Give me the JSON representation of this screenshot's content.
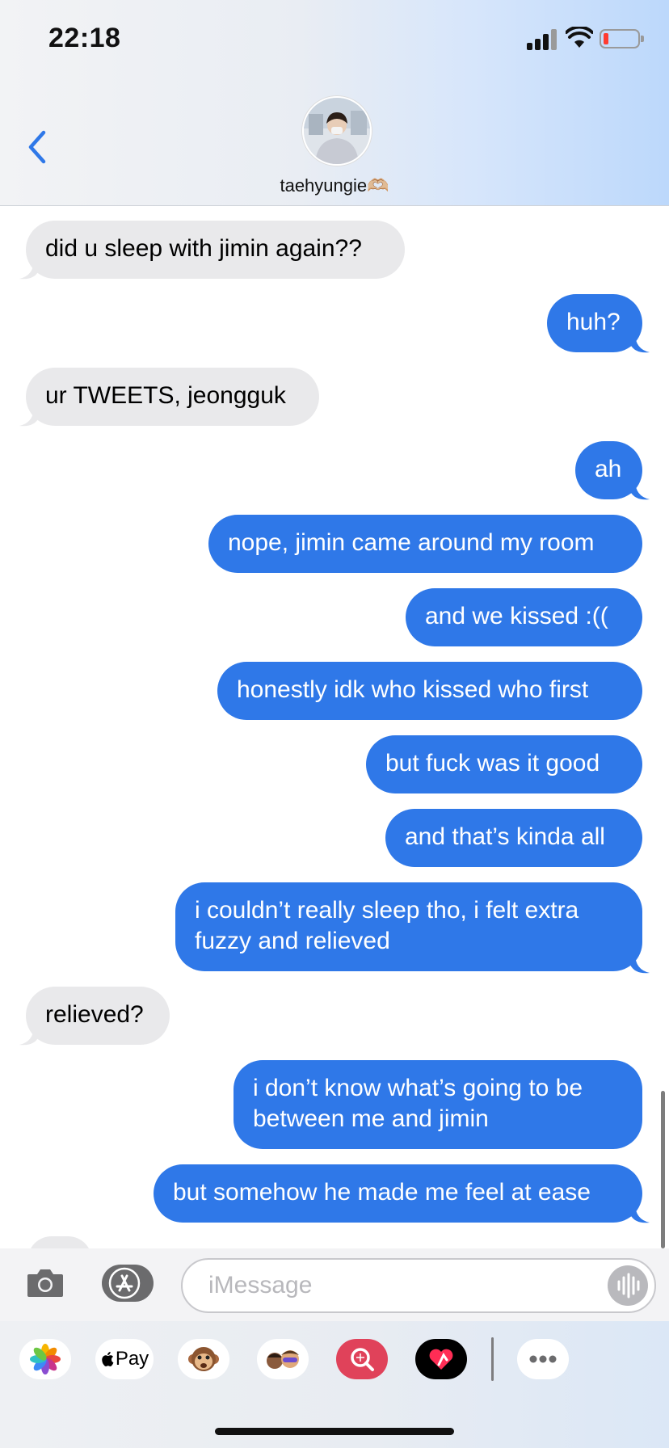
{
  "status_bar": {
    "time": "22:18"
  },
  "contact": {
    "name": "taehyungie🫶🏼"
  },
  "messages": [
    {
      "from": "them",
      "text": "did u sleep with jimin again??"
    },
    {
      "from": "me",
      "text": "huh?"
    },
    {
      "from": "them",
      "text": "ur TWEETS, jeongguk"
    },
    {
      "from": "me",
      "text": "ah"
    },
    {
      "from": "me",
      "text": "nope, jimin came around my room"
    },
    {
      "from": "me",
      "text": "and we kissed :(("
    },
    {
      "from": "me",
      "text": "honestly idk who kissed who first"
    },
    {
      "from": "me",
      "text": "but fuck was it good"
    },
    {
      "from": "me",
      "text": "and that’s kinda all"
    },
    {
      "from": "me",
      "text": "i couldn’t really sleep tho, i felt extra fuzzy and relieved"
    },
    {
      "from": "them",
      "text": "relieved?"
    },
    {
      "from": "me",
      "text": "i don’t know what’s going to be between me and jimin"
    },
    {
      "from": "me",
      "text": "but somehow he made me feel at ease"
    }
  ],
  "compose": {
    "placeholder": "iMessage"
  },
  "app_drawer": {
    "items": [
      "photos-icon",
      "apple-pay-icon",
      "animoji-icon",
      "memoji-icon",
      "search-images-icon",
      "digital-touch-icon",
      "more-icon"
    ],
    "apple_pay_label": "Pay"
  },
  "colors": {
    "outgoing": "#2f78e8",
    "incoming": "#e9e9eb",
    "accent": "#2f78e8"
  }
}
